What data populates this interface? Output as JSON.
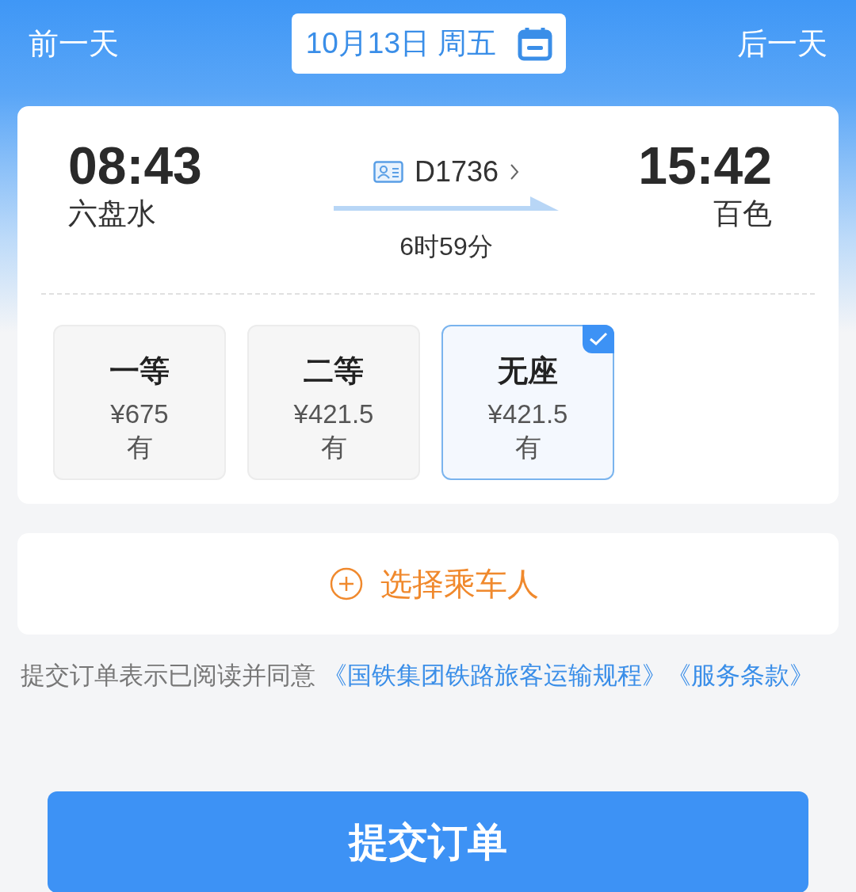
{
  "nav": {
    "prev": "前一天",
    "date": "10月13日 周五",
    "next": "后一天"
  },
  "train": {
    "depart_time": "08:43",
    "depart_station": "六盘水",
    "number": "D1736",
    "duration": "6时59分",
    "arrive_time": "15:42",
    "arrive_station": "百色"
  },
  "seats": [
    {
      "class": "一等",
      "price": "¥675",
      "availability": "有",
      "selected": false
    },
    {
      "class": "二等",
      "price": "¥421.5",
      "availability": "有",
      "selected": false
    },
    {
      "class": "无座",
      "price": "¥421.5",
      "availability": "有",
      "selected": true
    }
  ],
  "passenger_button": "选择乘车人",
  "terms": {
    "text": "提交订单表示已阅读并同意",
    "links": [
      "《国铁集团铁路旅客运输规程》",
      "《服务条款》"
    ]
  },
  "submit_button": "提交订单"
}
